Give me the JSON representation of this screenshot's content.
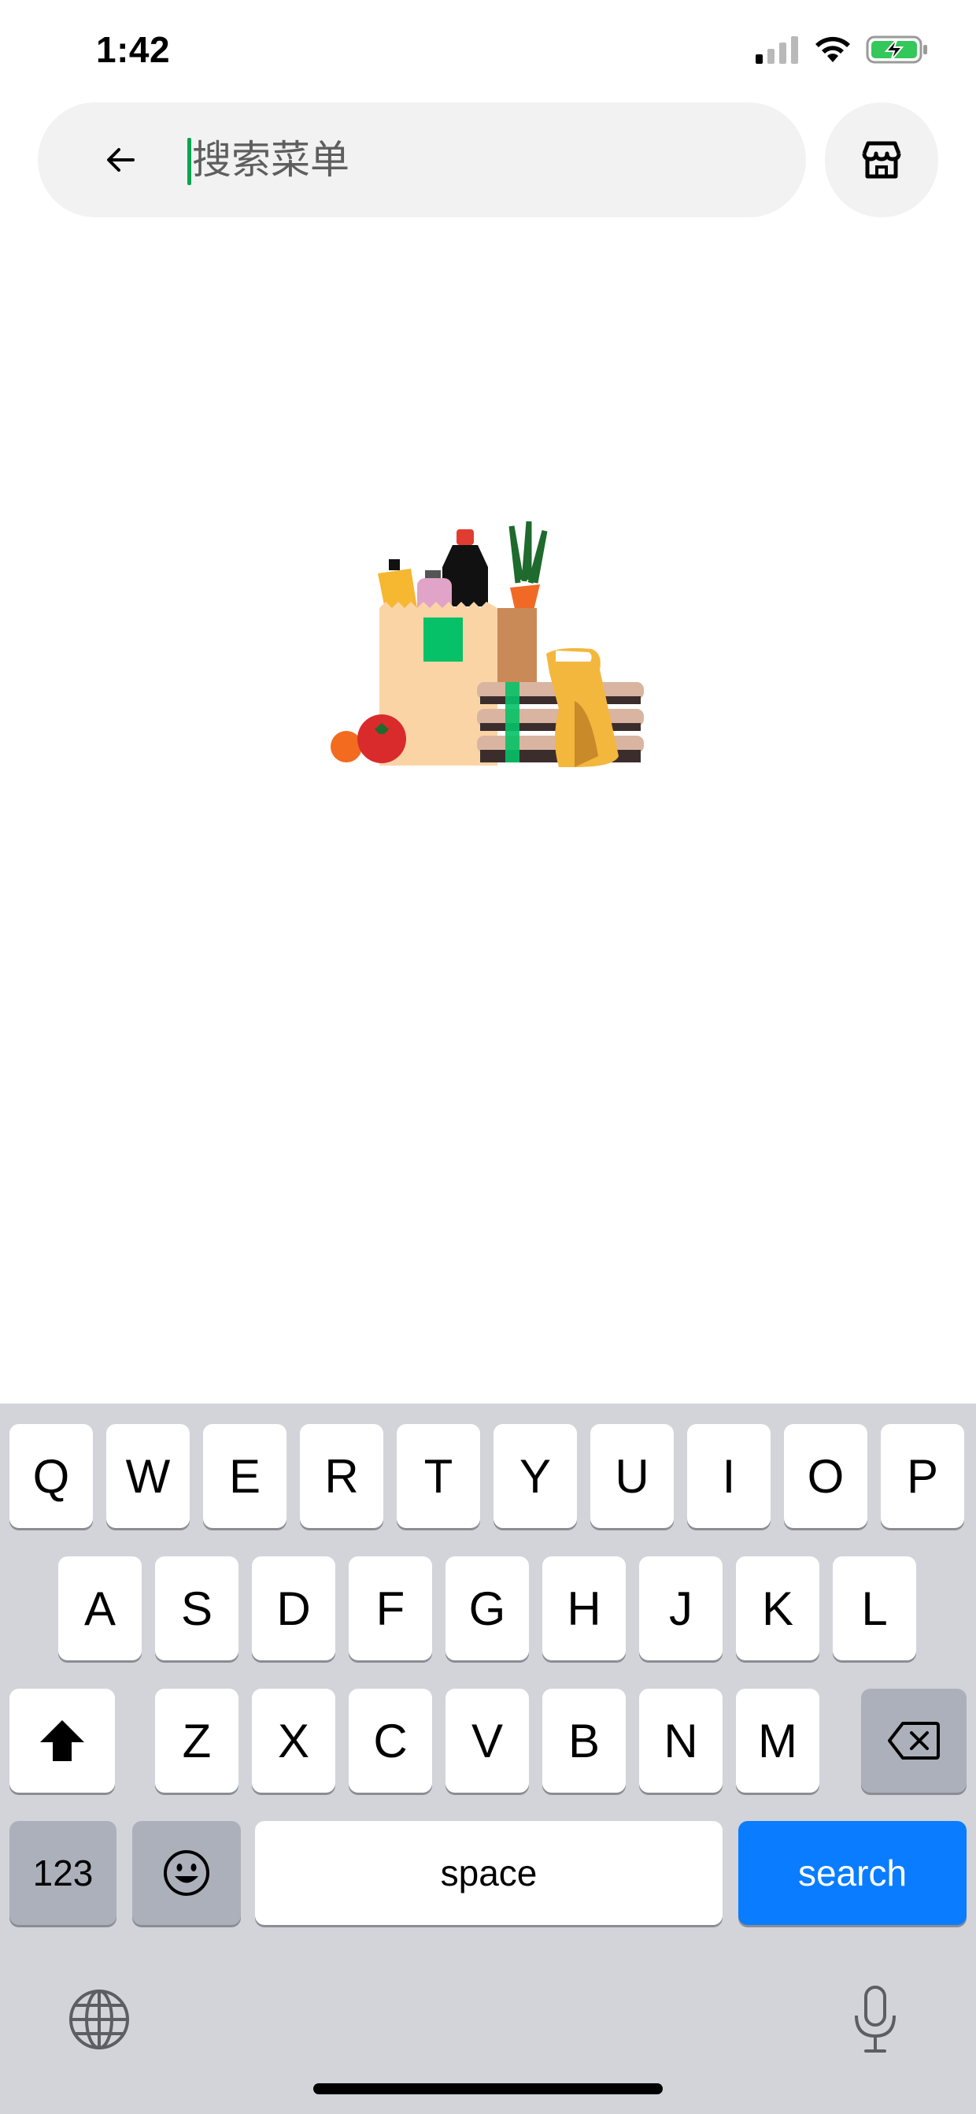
{
  "status_bar": {
    "time": "1:42",
    "icons": [
      "cellular-signal-icon",
      "wifi-icon",
      "battery-charging-icon"
    ]
  },
  "search": {
    "placeholder": "搜索菜单",
    "value": "",
    "back_icon": "arrow-left-icon",
    "store_icon": "storefront-icon",
    "caret_color": "#06a64e"
  },
  "illustration": {
    "icon": "grocery-bag-illustration"
  },
  "keyboard": {
    "row1": [
      "Q",
      "W",
      "E",
      "R",
      "T",
      "Y",
      "U",
      "I",
      "O",
      "P"
    ],
    "row2": [
      "A",
      "S",
      "D",
      "F",
      "G",
      "H",
      "J",
      "K",
      "L"
    ],
    "row3": [
      "Z",
      "X",
      "C",
      "V",
      "B",
      "N",
      "M"
    ],
    "shift_icon": "shift-icon",
    "delete_icon": "backspace-icon",
    "numbers_label": "123",
    "emoji_icon": "emoji-icon",
    "space_label": "space",
    "search_label": "search",
    "globe_icon": "globe-icon",
    "mic_icon": "microphone-icon",
    "search_key_color": "#0a7cff"
  }
}
